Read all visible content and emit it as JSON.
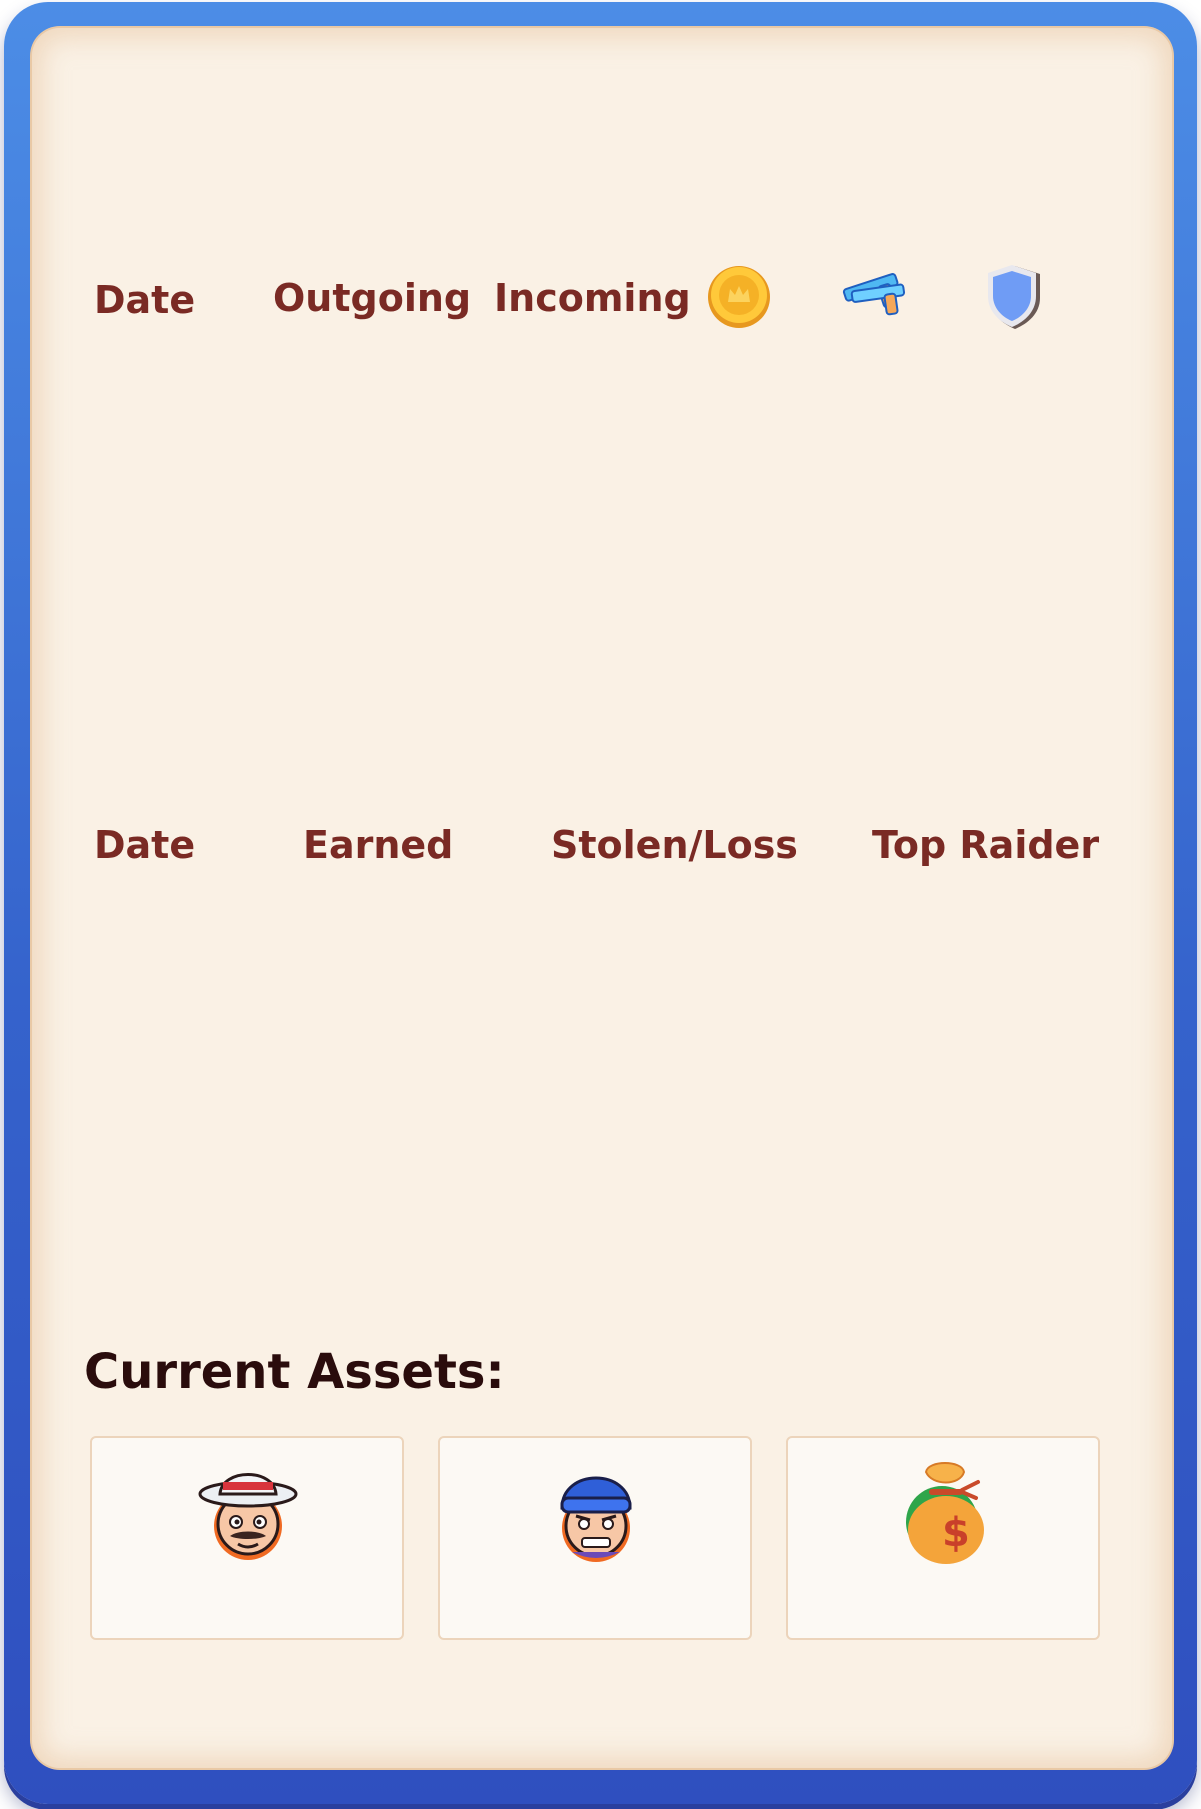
{
  "transactions_table": {
    "headers": {
      "date": "Date",
      "outgoing": "Outgoing",
      "incoming": "Incoming"
    },
    "header_icons": [
      "gold-coin-icon",
      "pistols-icon",
      "shield-icon"
    ]
  },
  "raids_table": {
    "headers": {
      "date": "Date",
      "earned": "Earned",
      "stolen_loss": "Stolen/Loss",
      "top_raider": "Top Raider"
    }
  },
  "current_assets": {
    "title": "Current Assets:",
    "cards": [
      {
        "icon": "gangster-fedora-avatar-icon"
      },
      {
        "icon": "thief-beanie-avatar-icon"
      },
      {
        "icon": "money-bag-icon"
      }
    ]
  },
  "colors": {
    "frame_blue": "#3563cc",
    "panel_bg": "#faf1e5",
    "header_text": "#7a2a24",
    "title_text": "#2a0c0c"
  }
}
